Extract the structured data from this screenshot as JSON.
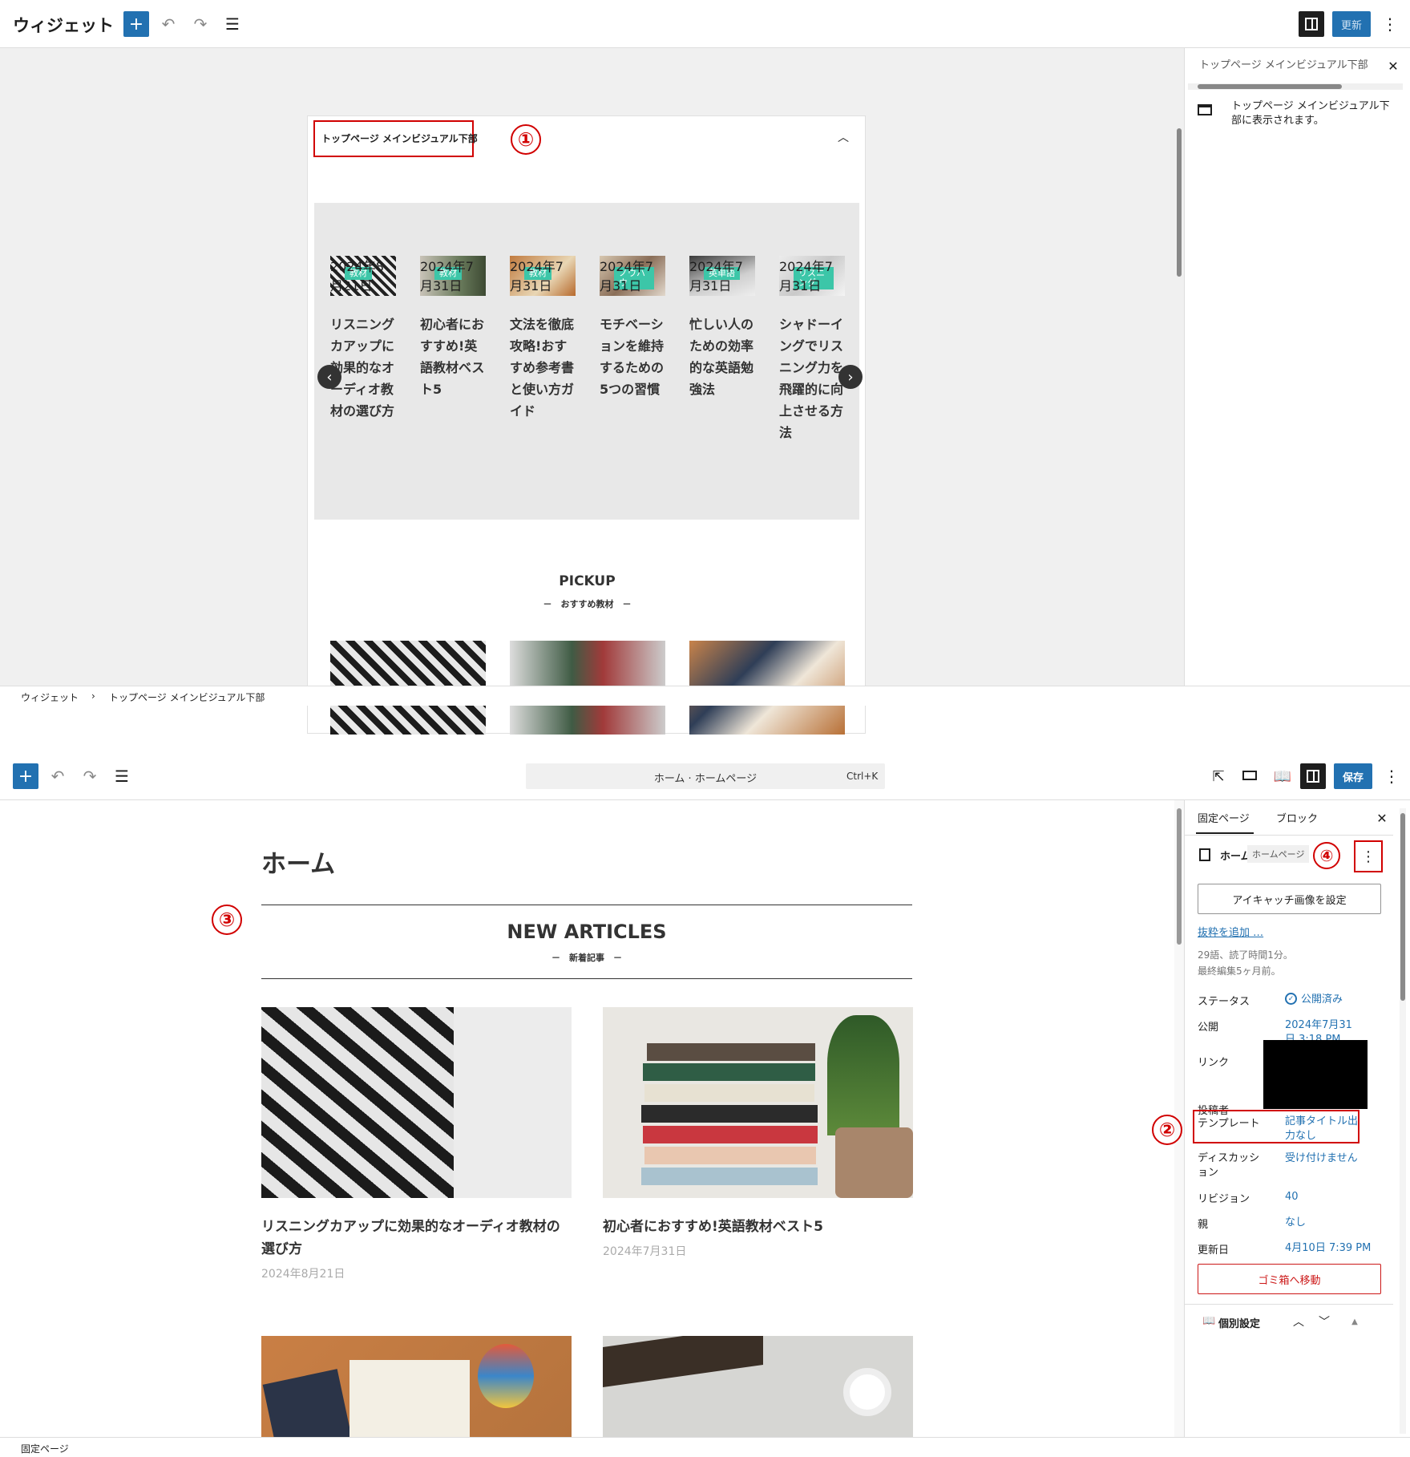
{
  "widgets_editor": {
    "title": "ウィジェット",
    "update_label": "更新",
    "widget_area_title": "トップページ メインビジュアル下部",
    "annotation_1": "①",
    "sidebar_title": "トップページ メインビジュアル下部",
    "sidebar_desc": "トップページ メインビジュアル下部に表示されます。",
    "breadcrumb_root": "ウィジェット",
    "breadcrumb_sep": "›",
    "breadcrumb_current": "トップページ メインビジュアル下部",
    "slider_cards": [
      {
        "tag": "教材",
        "title": "リスニングカアップに効果的なオーディオ教材の選び方",
        "date": "2024年8月21日"
      },
      {
        "tag": "教材",
        "title": "初心者におすすめ!英語教材ベスト5",
        "date": "2024年7月31日"
      },
      {
        "tag": "教材",
        "title": "文法を徹底攻略!おすすめ参考書と使い方ガイド",
        "date": "2024年7月31日"
      },
      {
        "tag": "ノウハウ",
        "title": "モチベーションを維持するための5つの習慣",
        "date": "2024年7月31日"
      },
      {
        "tag": "英単語",
        "title": "忙しい人のための効率的な英語勉強法",
        "date": "2024年7月31日"
      },
      {
        "tag": "リスニング",
        "title": "シャドーイングでリスニング力を飛躍的に向上させる方法",
        "date": "2024年7月31日"
      }
    ],
    "pickup_title": "PICKUP",
    "pickup_sub": "－　おすすめ教材　－"
  },
  "page_editor": {
    "command_bar": "ホーム · ホームページ",
    "command_shortcut": "Ctrl+K",
    "save_label": "保存",
    "page_title": "ホーム",
    "annotation_3": "③",
    "section_title": "NEW ARTICLES",
    "section_sub": "－　新着記事　－",
    "articles": [
      {
        "title": "リスニングカアップに効果的なオーディオ教材の選び方",
        "date": "2024年8月21日"
      },
      {
        "title": "初心者におすすめ!英語教材ベスト5",
        "date": "2024年7月31日"
      }
    ],
    "footer_label": "固定ページ",
    "sidebar": {
      "tab_page": "固定ページ",
      "tab_block": "ブロック",
      "page_name": "ホーム",
      "page_badge": "ホームページ",
      "annotation_4": "④",
      "annotation_2": "②",
      "featured_image_btn": "アイキャッチ画像を設定",
      "excerpt_link": "抜粋を追加 …",
      "word_count": "29語、読了時間1分。",
      "last_edited": "最終編集5ヶ月前。",
      "rows": {
        "status_k": "ステータス",
        "status_v": "公開済み",
        "publish_k": "公開",
        "publish_v": "2024年7月31日 3:18 PM",
        "link_k": "リンク",
        "author_k": "投稿者",
        "template_k": "テンプレート",
        "template_v": "記事タイトル出力なし",
        "discussion_k": "ディスカッション",
        "discussion_v": "受け付けません",
        "revisions_k": "リビジョン",
        "revisions_v": "40",
        "parent_k": "親",
        "parent_v": "なし",
        "modified_k": "更新日",
        "modified_v": "4月10日 7:39 PM"
      },
      "trash_btn": "ゴミ箱へ移動",
      "custom_settings": "個別設定"
    }
  },
  "colors": {
    "accent": "#2271b1",
    "annotation": "#d10000",
    "tag": "#3cc6a8"
  }
}
